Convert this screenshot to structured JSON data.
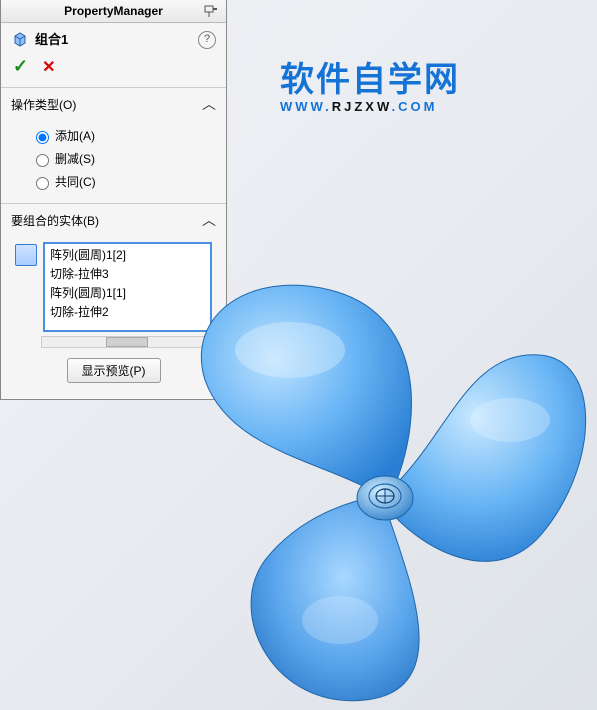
{
  "panel": {
    "title": "PropertyManager",
    "feature": "组合1",
    "ok_tip": "确定",
    "cancel_tip": "取消"
  },
  "opType": {
    "header": "操作类型(O)",
    "options": [
      {
        "label": "添加(A)",
        "checked": true
      },
      {
        "label": "删减(S)",
        "checked": false
      },
      {
        "label": "共同(C)",
        "checked": false
      }
    ]
  },
  "bodies": {
    "header": "要组合的实体(B)",
    "items": [
      "阵列(圆周)1[2]",
      "切除-拉伸3",
      "阵列(圆周)1[1]",
      "切除-拉伸2"
    ],
    "previewBtn": "显示预览(P)"
  },
  "watermark": {
    "main": "软件自学网",
    "sub_pre": "WWW.",
    "sub_mid": "RJZXW",
    "sub_post": ".COM"
  }
}
